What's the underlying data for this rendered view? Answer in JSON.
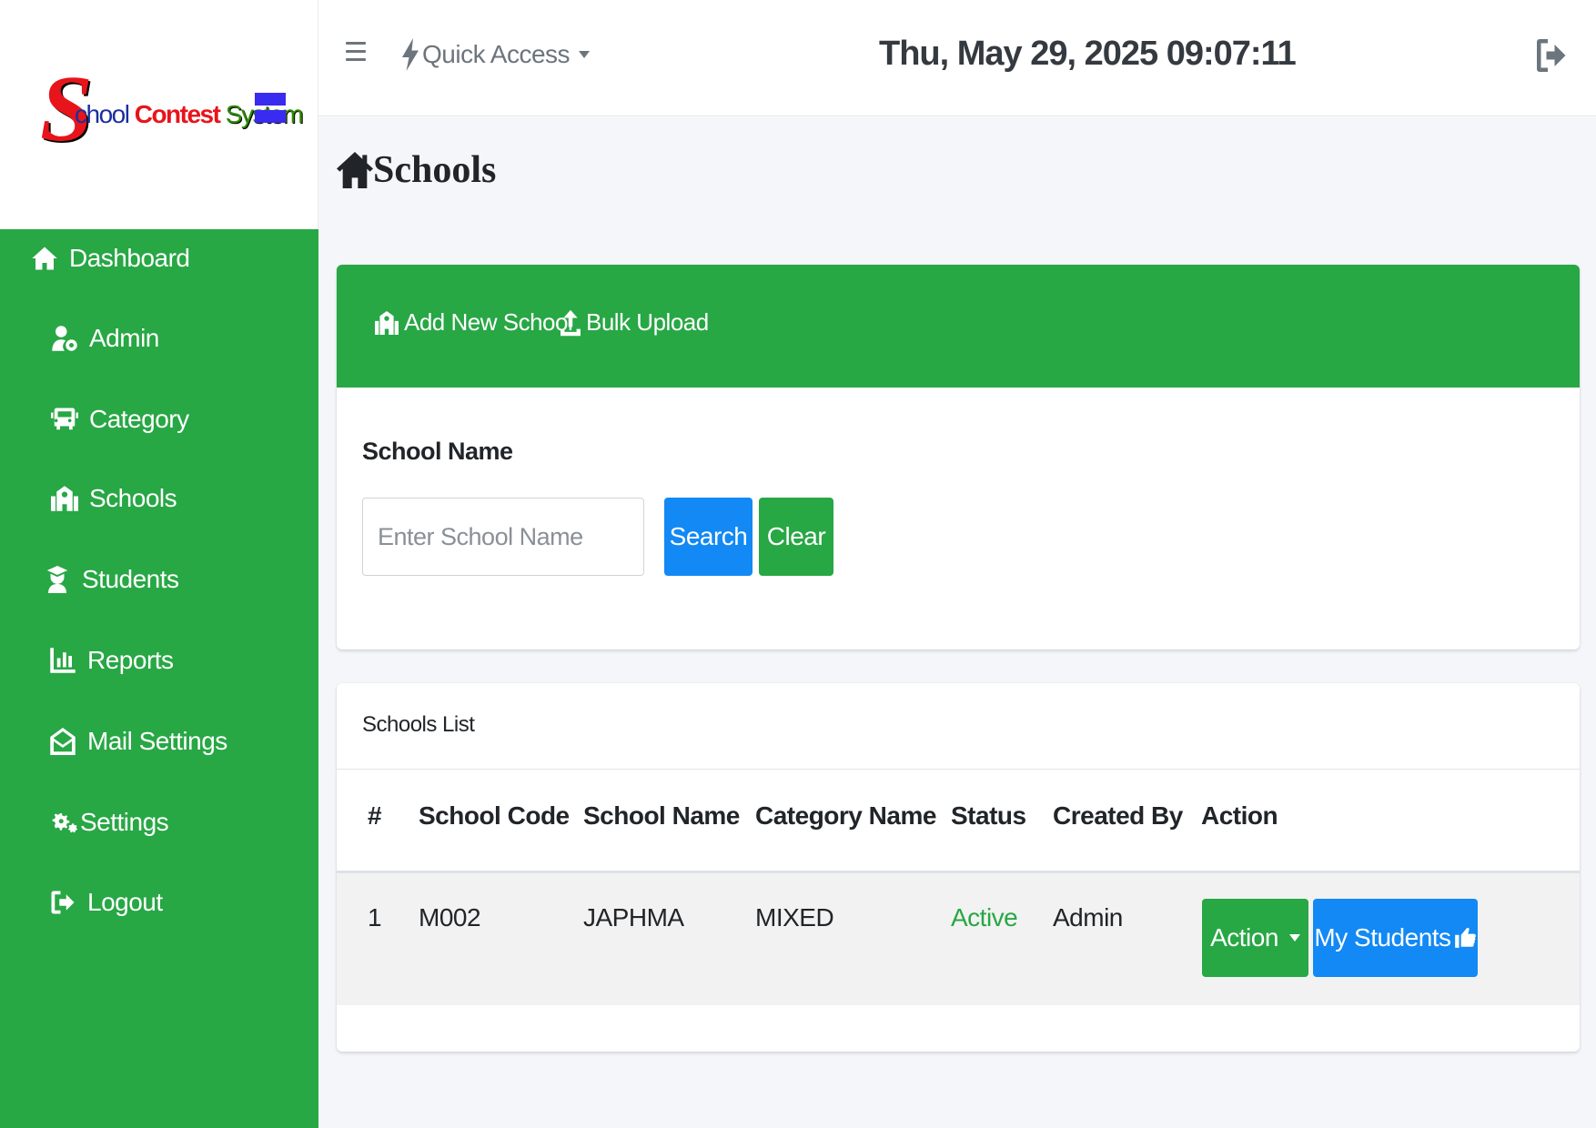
{
  "brand": {
    "logo_letter": "S",
    "logo_word1": "chool",
    "logo_word2": "Contest",
    "logo_word3": "System"
  },
  "sidebar": {
    "items": [
      {
        "label": "Dashboard",
        "icon": "home-icon"
      },
      {
        "label": "Admin",
        "icon": "user-gear-icon"
      },
      {
        "label": "Category",
        "icon": "school-bus-icon"
      },
      {
        "label": "Schools",
        "icon": "school-building-icon"
      },
      {
        "label": "Students",
        "icon": "graduate-icon"
      },
      {
        "label": "Reports",
        "icon": "bar-chart-icon"
      },
      {
        "label": "Mail Settings",
        "icon": "envelope-open-icon"
      },
      {
        "label": "Settings",
        "icon": "gears-icon"
      },
      {
        "label": "Logout",
        "icon": "sign-out-icon"
      }
    ]
  },
  "topbar": {
    "quick_access_label": "Quick Access",
    "datetime": "Thu, May 29, 2025 09:07:11"
  },
  "page": {
    "title": "Schools"
  },
  "toolbar": {
    "add_label": "Add New School",
    "bulk_label": "Bulk Upload"
  },
  "search": {
    "label": "School Name",
    "placeholder": "Enter School Name",
    "value": "",
    "search_label": "Search",
    "clear_label": "Clear"
  },
  "list": {
    "title": "Schools List",
    "columns": [
      "#",
      "School Code",
      "School Name",
      "Category Name",
      "Status",
      "Created By",
      "Action"
    ],
    "rows": [
      {
        "index": "1",
        "code": "M002",
        "name": "JAPHMA",
        "category": "MIXED",
        "status": "Active",
        "created_by": "Admin",
        "action_label": "Action",
        "students_label": "My Students"
      }
    ]
  },
  "colors": {
    "primary_green": "#28a745",
    "primary_blue": "#1289f4",
    "page_bg": "#f4f6f9"
  }
}
